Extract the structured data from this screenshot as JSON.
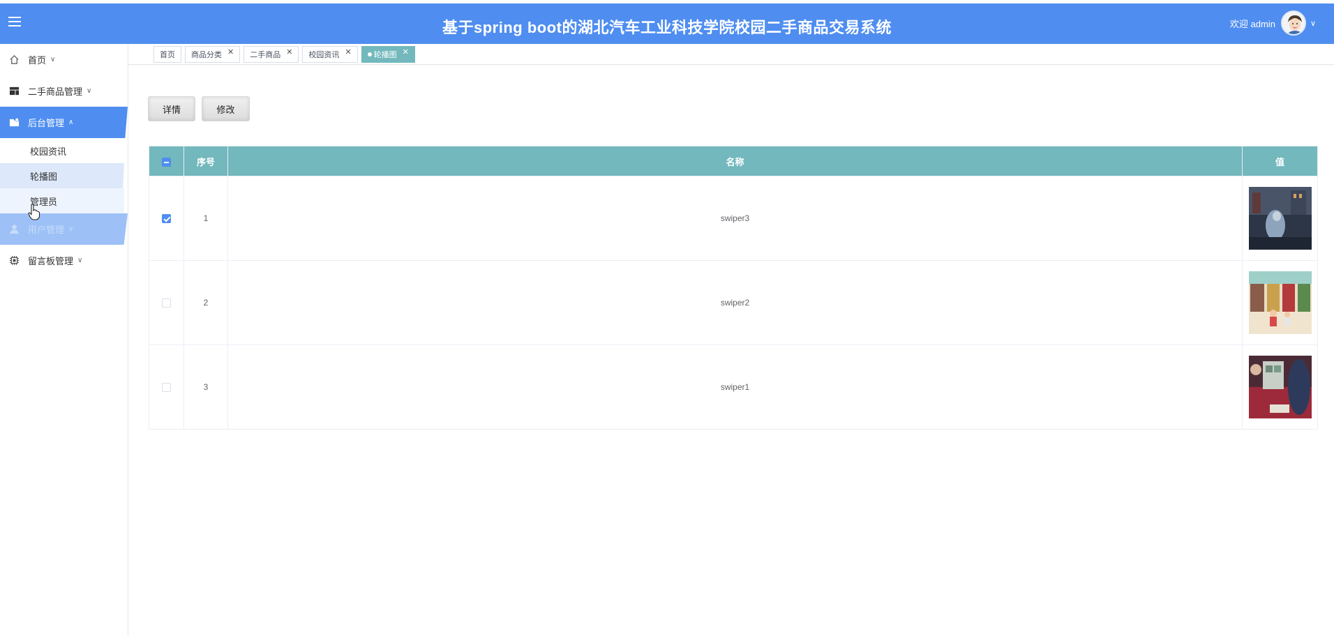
{
  "header": {
    "title": "基于spring boot的湖北汽车工业科技学院校园二手商品交易系统",
    "welcome": "欢迎 admin",
    "menu_icon": "hamburger-icon",
    "caret_icon": "chevron-down-icon"
  },
  "sidebar": {
    "items": [
      {
        "label": "首页",
        "icon": "home-icon"
      },
      {
        "label": "二手商品管理",
        "icon": "layout-icon"
      },
      {
        "label": "后台管理",
        "icon": "folder-icon"
      },
      {
        "label": "用户管理",
        "icon": "user-icon"
      },
      {
        "label": "留言板管理",
        "icon": "chip-icon"
      }
    ],
    "sub_items": [
      {
        "label": "校园资讯"
      },
      {
        "label": "轮播图"
      },
      {
        "label": "管理员"
      }
    ]
  },
  "tabs": [
    {
      "label": "首页"
    },
    {
      "label": "商品分类"
    },
    {
      "label": "二手商品"
    },
    {
      "label": "校园资讯"
    },
    {
      "label": "轮播图"
    }
  ],
  "toolbar": {
    "detail_label": "详情",
    "edit_label": "修改"
  },
  "table": {
    "headers": {
      "index": "序号",
      "name": "名称",
      "value": "值"
    },
    "rows": [
      {
        "index": "1",
        "name": "swiper3",
        "checked": true
      },
      {
        "index": "2",
        "name": "swiper2",
        "checked": false
      },
      {
        "index": "3",
        "name": "swiper1",
        "checked": false
      }
    ]
  },
  "colors": {
    "primary": "#4f8ef0",
    "table_header": "#72b8bd",
    "selected_sub": "#dde8fb"
  }
}
